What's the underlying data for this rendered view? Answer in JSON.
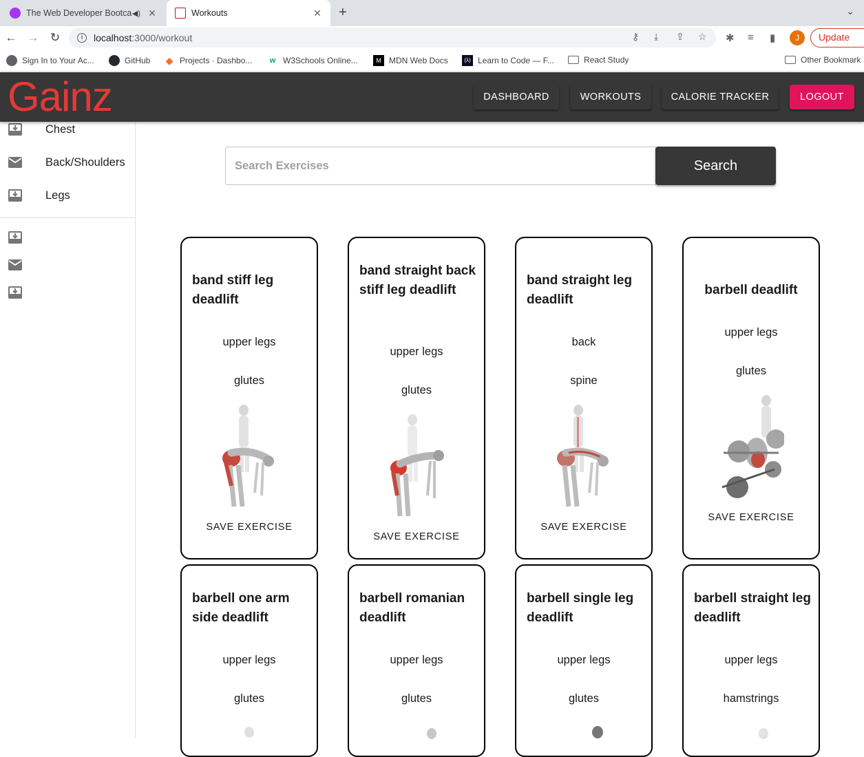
{
  "browser": {
    "tabs": [
      {
        "title": "The Web Developer Bootca"
      },
      {
        "title": "Workouts"
      }
    ],
    "url_host": "localhost",
    "url_path": ":3000/workout",
    "update_label": "Update",
    "avatar_letter": "J"
  },
  "bookmarks": [
    {
      "label": "Sign In to Your Ac..."
    },
    {
      "label": "GitHub"
    },
    {
      "label": "Projects · Dashbo..."
    },
    {
      "label": "W3Schools Online..."
    },
    {
      "label": "MDN Web Docs"
    },
    {
      "label": "Learn to Code — F..."
    },
    {
      "label": "React Study"
    },
    {
      "label": "Other Bookmark"
    }
  ],
  "app": {
    "logo": "Gainz",
    "nav": [
      "DASHBOARD",
      "WORKOUTS",
      "CALORIE TRACKER",
      "LOGOUT"
    ]
  },
  "sidebar": {
    "items": [
      {
        "label": "Chest",
        "icon": "inbox-icon"
      },
      {
        "label": "Back/Shoulders",
        "icon": "mail-icon"
      },
      {
        "label": "Legs",
        "icon": "inbox-icon"
      }
    ],
    "secondary_icons": [
      "inbox-icon",
      "mail-icon",
      "inbox-icon"
    ]
  },
  "search": {
    "placeholder": "Search Exercises",
    "button_label": "Search"
  },
  "exercises": [
    {
      "name": "band stiff leg deadlift",
      "body_part": "upper legs",
      "target": "glutes",
      "action": "SAVE EXERCISE"
    },
    {
      "name": "band straight back stiff leg deadlift",
      "body_part": "upper legs",
      "target": "glutes",
      "action": "SAVE EXERCISE"
    },
    {
      "name": "band straight leg deadlift",
      "body_part": "back",
      "target": "spine",
      "action": "SAVE EXERCISE"
    },
    {
      "name": "barbell deadlift",
      "body_part": "upper legs",
      "target": "glutes",
      "action": "SAVE EXERCISE"
    },
    {
      "name": "barbell one arm side deadlift",
      "body_part": "upper legs",
      "target": "glutes"
    },
    {
      "name": "barbell romanian deadlift",
      "body_part": "upper legs",
      "target": "glutes"
    },
    {
      "name": "barbell single leg deadlift",
      "body_part": "upper legs",
      "target": "glutes"
    },
    {
      "name": "barbell straight leg deadlift",
      "body_part": "upper legs",
      "target": "hamstrings"
    }
  ]
}
